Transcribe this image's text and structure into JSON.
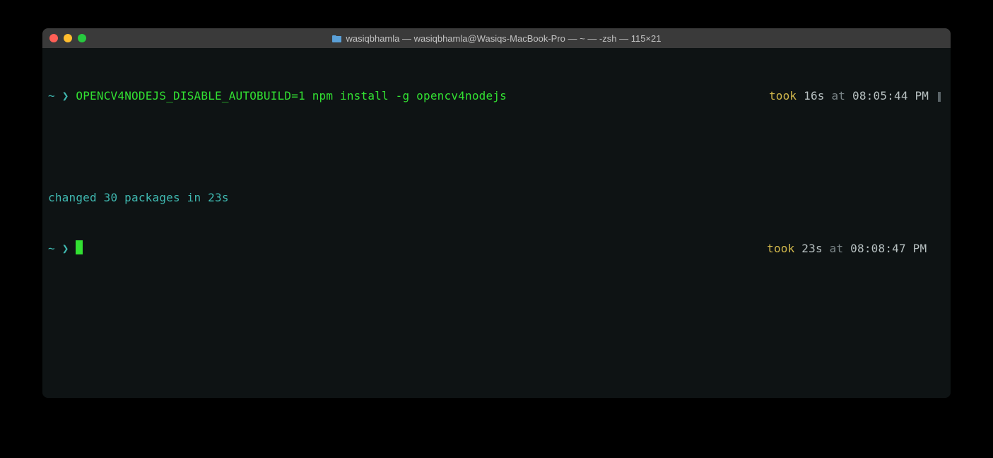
{
  "window": {
    "title": "wasiqbhamla — wasiqbhamla@Wasiqs-MacBook-Pro — ~ — -zsh — 115×21"
  },
  "lines": {
    "l1": {
      "prompt_path": "~",
      "prompt_symbol": "❯",
      "command": "OPENCV4NODEJS_DISABLE_AUTOBUILD=1 npm install -g opencv4nodejs",
      "took_label": "took",
      "took_value": "16s",
      "at_label": "at",
      "time": "08:05:44 PM"
    },
    "l2": {
      "blank": ""
    },
    "l3": {
      "output": "changed 30 packages in 23s"
    },
    "l4": {
      "prompt_path": "~",
      "prompt_symbol": "❯",
      "took_label": "took",
      "took_value": "23s",
      "at_label": "at",
      "time": "08:08:47 PM"
    }
  }
}
